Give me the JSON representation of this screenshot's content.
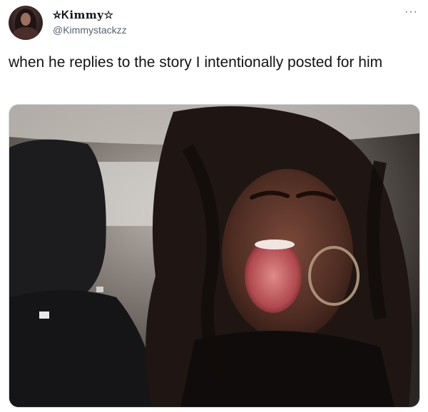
{
  "author": {
    "display_name": "☆Ꮶimmy☆",
    "handle": "@Kimmystackzz"
  },
  "more_icon": "more-horizontal-icon",
  "tweet": {
    "text": "when he replies to the story I intentionally posted for him"
  },
  "colors": {
    "text_primary": "#0f1419",
    "text_secondary": "#536471",
    "border": "#cfd9de"
  }
}
